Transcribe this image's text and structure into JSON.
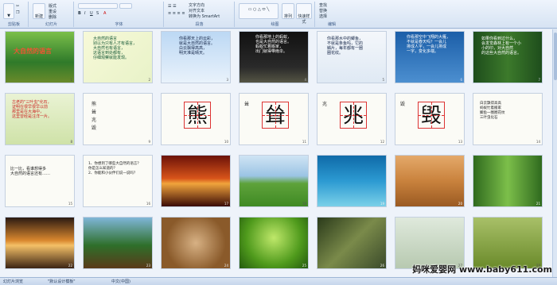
{
  "ribbon": {
    "groups": [
      "剪贴板",
      "幻灯片",
      "字体",
      "段落",
      "绘图",
      "编辑"
    ],
    "new_slide": "新建",
    "clipboard": "剪贴板",
    "buttons": [
      "版式",
      "重设",
      "删除"
    ],
    "para_items": [
      "文字方向",
      "对齐文本",
      "转换为 SmartArt"
    ],
    "shape_items": [
      "排列",
      "快速样式"
    ],
    "edit_items": [
      "查找",
      "替换",
      "选择"
    ]
  },
  "slides": [
    {
      "n": "1",
      "text": "大自然的语言"
    },
    {
      "n": "2",
      "text": "大自然的语言\n别以为只有人才有语言，\n大自然也有语言，\n这语言到处都有，\n仔细观察就能发现。"
    },
    {
      "n": "3",
      "text": "你看那天上的云彩，\n就是大自然的语言。\n白云飘得高高，\n明天准是晴天。"
    },
    {
      "n": "4",
      "text": "你看那地上的蚂蚁，\n也是大自然的语言。\n蚂蚁忙着搬家，\n出门就得带雨伞。"
    },
    {
      "n": "5",
      "text": "你看那水中的鲫鱼，\n不就是条鱼吗，它的\n鳞片，每年都有一圈\n圈花纹。"
    },
    {
      "n": "6",
      "text": "你看那空中飞翔的大雁，\n不就是春天吗？一会儿\n排成人字，一会儿排成\n一字，变化多端。"
    },
    {
      "n": "7",
      "text": "如果你看到过什么，\n会发觉森林上有一个小\n小的印，对大自然\n的这些大自然的语言。"
    },
    {
      "n": "8",
      "text": "古老的\"三叶虫\"化石，\n证明在很早很早以前\n那里是在大海中，\n这里曾经是汪洋一片。"
    },
    {
      "n": "9",
      "chars": [
        "熊",
        "耸",
        "兆",
        "毁"
      ]
    },
    {
      "n": "10",
      "char": "熊"
    },
    {
      "n": "11",
      "char": "耸",
      "side": "耸"
    },
    {
      "n": "12",
      "char": "兆",
      "side": "兆"
    },
    {
      "n": "13",
      "char": "毁",
      "side": "毁"
    },
    {
      "n": "14",
      "text": "白云飘得高高\n蚂蚁忙着搬家\n鲫鱼一圈圈花纹\n三叶虫化石"
    },
    {
      "n": "15",
      "text": "比一比，看谁想得多\n大自然的语言还有……"
    },
    {
      "n": "16",
      "text": "1、你想到了哪些大自然的语言？\n你是怎么知道的？\n2、你能和小伙伴们说一说吗？"
    },
    {
      "n": "17",
      "text": ""
    },
    {
      "n": "18",
      "text": ""
    },
    {
      "n": "19",
      "text": ""
    },
    {
      "n": "20",
      "text": ""
    },
    {
      "n": "21",
      "text": ""
    },
    {
      "n": "22",
      "text": ""
    },
    {
      "n": "23",
      "text": ""
    },
    {
      "n": "24",
      "text": ""
    },
    {
      "n": "25",
      "text": ""
    },
    {
      "n": "26",
      "text": ""
    },
    {
      "n": "27",
      "text": ""
    },
    {
      "n": "28",
      "text": ""
    }
  ],
  "status": {
    "left": "幻灯片浏览",
    "theme": "\"默认设计模板\"",
    "lang": "中文(中国)"
  },
  "watermark": "妈咪爱婴网 www.baby611.com"
}
